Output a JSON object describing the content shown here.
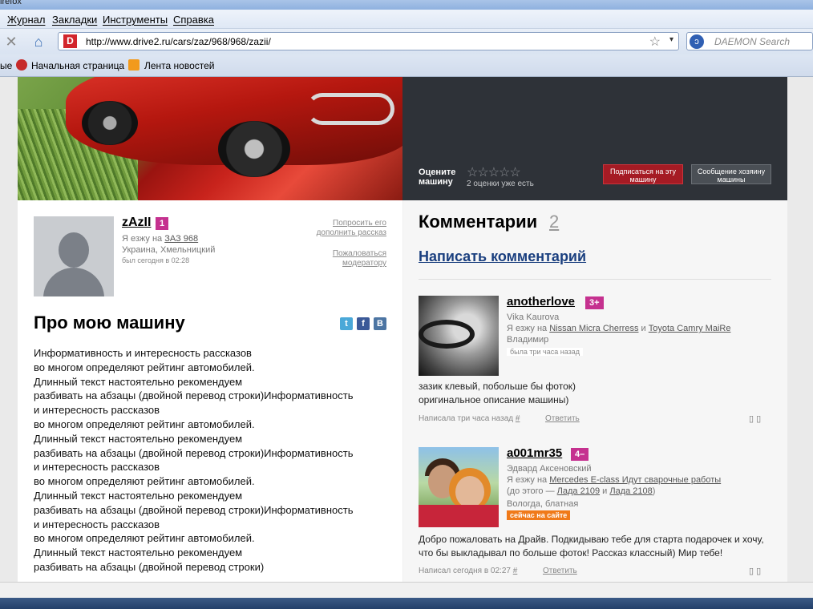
{
  "browser": {
    "title": "irefox",
    "menu": [
      "Журнал",
      "Закладки",
      "Инструменты",
      "Справка"
    ],
    "url": "http://www.drive2.ru/cars/zaz/968/968/zazii/",
    "search_placeholder": "DAEMON Search",
    "bookmarks": [
      "ые",
      "Начальная страница",
      "Лента новостей"
    ]
  },
  "rating": {
    "title": "Оцените машину",
    "stars": "☆☆☆☆☆",
    "count": "2 оценки уже есть",
    "subscribe": "Подписаться на эту машину",
    "message": "Сообщение хозяину машины"
  },
  "profile": {
    "username": "zAzII",
    "badge": "1",
    "drives_prefix": "Я езжу на",
    "car": "ЗАЗ 968",
    "location": "Украина, Хмельницкий",
    "seen": "был сегодня в 02:28",
    "ask_link_1": "Попросить его",
    "ask_link_2": "дополнить рассказ",
    "report_link_1": "Пожаловаться",
    "report_link_2": "модератору"
  },
  "about": {
    "title": "Про мою машину",
    "social": [
      "t",
      "f",
      "В"
    ],
    "lines": [
      "Информативность и интересность рассказов",
      "во многом определяют рейтинг автомобилей.",
      "Длинный текст настоятельно рекомендуем",
      "разбивать на абзацы (двойной перевод строки)Информативность",
      "и интересность рассказов",
      "во многом определяют рейтинг автомобилей.",
      "Длинный текст настоятельно рекомендуем",
      "разбивать на абзацы (двойной перевод строки)Информативность",
      "и интересность рассказов",
      "во многом определяют рейтинг автомобилей.",
      "Длинный текст настоятельно рекомендуем",
      "разбивать на абзацы (двойной перевод строки)Информативность",
      "и интересность рассказов",
      "во многом определяют рейтинг автомобилей.",
      "Длинный текст настоятельно рекомендуем",
      "разбивать на абзацы (двойной перевод строки)"
    ]
  },
  "comments": {
    "title": "Комментарии",
    "count": "2",
    "write": "Написать комментарий",
    "items": [
      {
        "user": "anotherlove",
        "badge": "3+",
        "name": "Vika Kaurova",
        "drives_prefix": "Я езжу на",
        "car1": "Nissan Micra Cherress",
        "and": "и",
        "car2": "Toyota Camry MaiRe",
        "city": "Владимир",
        "seen": "была три часа назад",
        "text1": "зазик клевый, побольше бы фоток)",
        "text2": "оригинальное описание машины)",
        "meta": "Написала три часа назад",
        "hash": "#",
        "reply": "Ответить",
        "icons": "▯ ▯"
      },
      {
        "user": "a001mr35",
        "badge": "4–",
        "name": "Эдвард Аксеновский",
        "drives_prefix": "Я езжу на",
        "car1": "Mercedes E-class Идут сварочные работы",
        "before_prefix": "(до этого —",
        "car2": "Лада 2109",
        "and": "и",
        "car3": "Лада 2108",
        "before_suffix": ")",
        "city": "Вологда, блатная",
        "online": "сейчас на сайте",
        "text1": "Добро пожаловать на Драйв. Подкидываю тебе для старта подарочек и хочу,",
        "text2": "что бы выкладывал по больше фоток! Рассказ классный) Мир тебе!",
        "meta": "Написал сегодня в 02:27",
        "hash": "#",
        "reply": "Ответить",
        "icons": "▯ ▯"
      }
    ]
  }
}
